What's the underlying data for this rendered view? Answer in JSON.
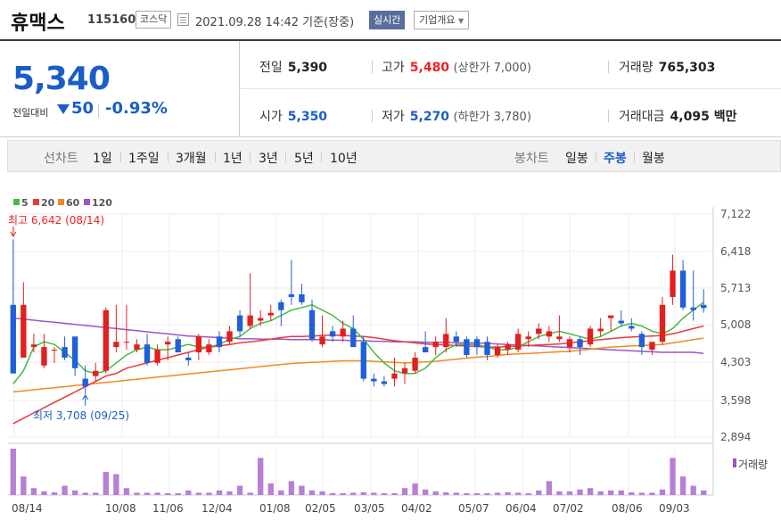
{
  "header": {
    "name": "휴맥스",
    "code": "115160",
    "market": "코스닥",
    "datetime": "2021.09.28 14:42",
    "basis": "기준(장중)",
    "realtime_label": "실시간",
    "company_label": "기업개요",
    "company_caret": "▼"
  },
  "price": {
    "current": "5,340",
    "change_label": "전일대비",
    "change": "50",
    "change_pct": "-0.93%",
    "direction": "down"
  },
  "stats": {
    "prev_label": "전일",
    "prev": "5,390",
    "high_label": "고가",
    "high": "5,480",
    "upper_limit": "(상한가 7,000)",
    "volume_label": "거래량",
    "volume": "765,303",
    "open_label": "시가",
    "open": "5,350",
    "low_label": "저가",
    "low": "5,270",
    "lower_limit": "(하한가 3,780)",
    "amount_label": "거래대금",
    "amount": "4,095 백만"
  },
  "periods": {
    "line_label": "선차트",
    "line_items": [
      "1일",
      "1주일",
      "3개월",
      "1년",
      "3년",
      "5년",
      "10년"
    ],
    "candle_label": "봉차트",
    "candle_items": [
      "일봉",
      "주봉",
      "월봉"
    ],
    "selected": "주봉"
  },
  "colors": {
    "up": "#e22020",
    "down": "#1f5fd8",
    "ma5": "#44bb44",
    "ma20": "#e83a3a",
    "ma60": "#f08a1e",
    "ma120": "#9a55c8",
    "volume": "#b77fd6"
  },
  "chart_data": {
    "type": "candlestick",
    "ylim": [
      2894,
      7122
    ],
    "y_ticks": [
      "7,122",
      "6,418",
      "5,713",
      "5,008",
      "4,303",
      "3,598",
      "2,894"
    ],
    "x_ticks": [
      "08/14",
      "10/08",
      "11/06",
      "12/04",
      "01/08",
      "02/05",
      "03/05",
      "04/02",
      "05/07",
      "06/04",
      "07/02",
      "08/06",
      "09/03"
    ],
    "legend": [
      {
        "name": "5",
        "color": "#44bb44"
      },
      {
        "name": "20",
        "color": "#e83a3a"
      },
      {
        "name": "60",
        "color": "#f08a1e"
      },
      {
        "name": "120",
        "color": "#9a55c8"
      }
    ],
    "volume_label": "거래량",
    "high_annotation": "최고 6,642 (08/14)",
    "low_annotation": "최저 3,708 (09/25)",
    "candles": [
      [
        5400,
        6642,
        4100,
        4100
      ],
      [
        4400,
        5830,
        4500,
        5400
      ],
      [
        4600,
        4850,
        4500,
        4650
      ],
      [
        4250,
        4850,
        4200,
        4600
      ],
      [
        4550,
        4600,
        4300,
        4550
      ],
      [
        4600,
        4800,
        4350,
        4400
      ],
      [
        4800,
        4800,
        4050,
        4200
      ],
      [
        4000,
        4250,
        3708,
        3850
      ],
      [
        4050,
        4300,
        3950,
        4150
      ],
      [
        4150,
        5350,
        4100,
        5300
      ],
      [
        4600,
        5400,
        4500,
        4700
      ],
      [
        4700,
        5400,
        4550,
        4700
      ],
      [
        4550,
        4750,
        4500,
        4650
      ],
      [
        4650,
        4850,
        4250,
        4300
      ],
      [
        4300,
        4650,
        4250,
        4550
      ],
      [
        4650,
        4800,
        4350,
        4700
      ],
      [
        4750,
        4800,
        4500,
        4500
      ],
      [
        4400,
        4500,
        4250,
        4350
      ],
      [
        4500,
        4850,
        4350,
        4800
      ],
      [
        4500,
        4750,
        4450,
        4650
      ],
      [
        4800,
        4900,
        4500,
        4600
      ],
      [
        4700,
        5000,
        4650,
        4900
      ],
      [
        5200,
        5300,
        4800,
        4900
      ],
      [
        5000,
        6000,
        4950,
        5200
      ],
      [
        5100,
        5300,
        5000,
        5150
      ],
      [
        5200,
        5400,
        5100,
        5250
      ],
      [
        5450,
        5500,
        5000,
        5300
      ],
      [
        5600,
        6250,
        5400,
        5550
      ],
      [
        5600,
        5800,
        5400,
        5450
      ],
      [
        5300,
        5500,
        4700,
        4750
      ],
      [
        4650,
        5200,
        4600,
        4800
      ],
      [
        4900,
        5000,
        4700,
        4800
      ],
      [
        4800,
        5100,
        4700,
        4950
      ],
      [
        4950,
        5200,
        4700,
        4600
      ],
      [
        4700,
        4800,
        3950,
        4000
      ],
      [
        4000,
        4100,
        3850,
        3950
      ],
      [
        3950,
        4050,
        3850,
        3900
      ],
      [
        4000,
        4400,
        3850,
        4100
      ],
      [
        4100,
        4300,
        3900,
        4200
      ],
      [
        4150,
        4500,
        4100,
        4400
      ],
      [
        4600,
        4900,
        4500,
        4500
      ],
      [
        4600,
        4800,
        4450,
        4700
      ],
      [
        4600,
        5150,
        4500,
        4850
      ],
      [
        4800,
        4900,
        4600,
        4700
      ],
      [
        4750,
        4800,
        4400,
        4450
      ],
      [
        4750,
        4800,
        4450,
        4600
      ],
      [
        4700,
        4800,
        4350,
        4450
      ],
      [
        4450,
        4650,
        4400,
        4600
      ],
      [
        4550,
        4700,
        4450,
        4650
      ],
      [
        4550,
        4950,
        4500,
        4850
      ],
      [
        4750,
        4900,
        4600,
        4800
      ],
      [
        4850,
        5050,
        4750,
        4950
      ],
      [
        4800,
        5000,
        4700,
        4900
      ],
      [
        4750,
        5200,
        4700,
        4800
      ],
      [
        4600,
        4800,
        4500,
        4750
      ],
      [
        4750,
        4800,
        4450,
        4600
      ],
      [
        4650,
        5000,
        4600,
        4950
      ],
      [
        4900,
        5150,
        4800,
        4950
      ],
      [
        5150,
        5200,
        4900,
        5200
      ],
      [
        5100,
        5300,
        5000,
        5050
      ],
      [
        5000,
        5150,
        4900,
        4950
      ],
      [
        4850,
        4900,
        4450,
        4600
      ],
      [
        4550,
        4700,
        4450,
        4700
      ],
      [
        4700,
        5550,
        4650,
        5400
      ],
      [
        5550,
        6350,
        5400,
        6050
      ],
      [
        6050,
        6250,
        5300,
        5350
      ],
      [
        5350,
        6050,
        5100,
        5300
      ],
      [
        5400,
        5700,
        5250,
        5340
      ]
    ],
    "ma5": [
      3900,
      4150,
      4600,
      4700,
      4650,
      4500,
      4350,
      4150,
      4100,
      4150,
      4300,
      4450,
      4550,
      4600,
      4550,
      4550,
      4600,
      4650,
      4600,
      4600,
      4650,
      4750,
      4800,
      4950,
      5050,
      5100,
      5200,
      5300,
      5350,
      5400,
      5300,
      5200,
      5050,
      4950,
      4750,
      4500,
      4300,
      4150,
      4100,
      4100,
      4200,
      4400,
      4550,
      4650,
      4650,
      4650,
      4600,
      4550,
      4550,
      4600,
      4700,
      4800,
      4850,
      4900,
      4850,
      4800,
      4750,
      4800,
      4900,
      5000,
      5050,
      5000,
      4900,
      4850,
      4950,
      5150,
      5300,
      5450
    ],
    "ma20": [
      3150,
      3250,
      3350,
      3450,
      3550,
      3650,
      3750,
      3850,
      3950,
      4050,
      4100,
      4200,
      4250,
      4300,
      4350,
      4400,
      4450,
      4500,
      4550,
      4600,
      4620,
      4650,
      4680,
      4700,
      4720,
      4750,
      4780,
      4800,
      4800,
      4810,
      4820,
      4830,
      4820,
      4810,
      4800,
      4780,
      4750,
      4720,
      4700,
      4680,
      4660,
      4650,
      4640,
      4630,
      4620,
      4610,
      4600,
      4600,
      4610,
      4620,
      4630,
      4640,
      4650,
      4660,
      4680,
      4700,
      4720,
      4740,
      4760,
      4780,
      4790,
      4800,
      4810,
      4820,
      4850,
      4900,
      4950,
      5000
    ],
    "ma60": [
      3750,
      3770,
      3790,
      3810,
      3830,
      3850,
      3870,
      3890,
      3910,
      3930,
      3950,
      3970,
      3990,
      4010,
      4030,
      4050,
      4070,
      4090,
      4110,
      4130,
      4150,
      4170,
      4190,
      4210,
      4230,
      4250,
      4270,
      4290,
      4300,
      4310,
      4320,
      4330,
      4340,
      4340,
      4340,
      4330,
      4320,
      4310,
      4300,
      4310,
      4320,
      4330,
      4350,
      4370,
      4390,
      4410,
      4420,
      4440,
      4460,
      4470,
      4480,
      4490,
      4500,
      4510,
      4520,
      4540,
      4560,
      4580,
      4600,
      4610,
      4620,
      4630,
      4640,
      4650,
      4680,
      4710,
      4740,
      4770
    ],
    "ma120": [
      5150,
      5130,
      5110,
      5090,
      5070,
      5050,
      5030,
      5010,
      4990,
      4970,
      4950,
      4930,
      4910,
      4890,
      4870,
      4850,
      4830,
      4810,
      4800,
      4790,
      4780,
      4770,
      4760,
      4760,
      4750,
      4750,
      4750,
      4740,
      4740,
      4740,
      4740,
      4730,
      4730,
      4720,
      4720,
      4710,
      4710,
      4700,
      4700,
      4700,
      4690,
      4690,
      4690,
      4680,
      4680,
      4680,
      4670,
      4660,
      4650,
      4640,
      4630,
      4620,
      4610,
      4600,
      4590,
      4580,
      4570,
      4560,
      4550,
      4540,
      4530,
      4520,
      4510,
      4500,
      4500,
      4500,
      4500,
      4480
    ],
    "volume": [
      100,
      40,
      15,
      8,
      6,
      20,
      10,
      5,
      5,
      50,
      45,
      15,
      5,
      5,
      5,
      4,
      4,
      10,
      5,
      5,
      10,
      8,
      20,
      5,
      80,
      25,
      10,
      30,
      20,
      10,
      8,
      4,
      4,
      5,
      6,
      5,
      4,
      4,
      15,
      25,
      12,
      8,
      6,
      5,
      4,
      4,
      4,
      5,
      6,
      5,
      4,
      10,
      30,
      8,
      8,
      12,
      15,
      8,
      10,
      10,
      6,
      5,
      5,
      12,
      80,
      40,
      20,
      10
    ]
  }
}
